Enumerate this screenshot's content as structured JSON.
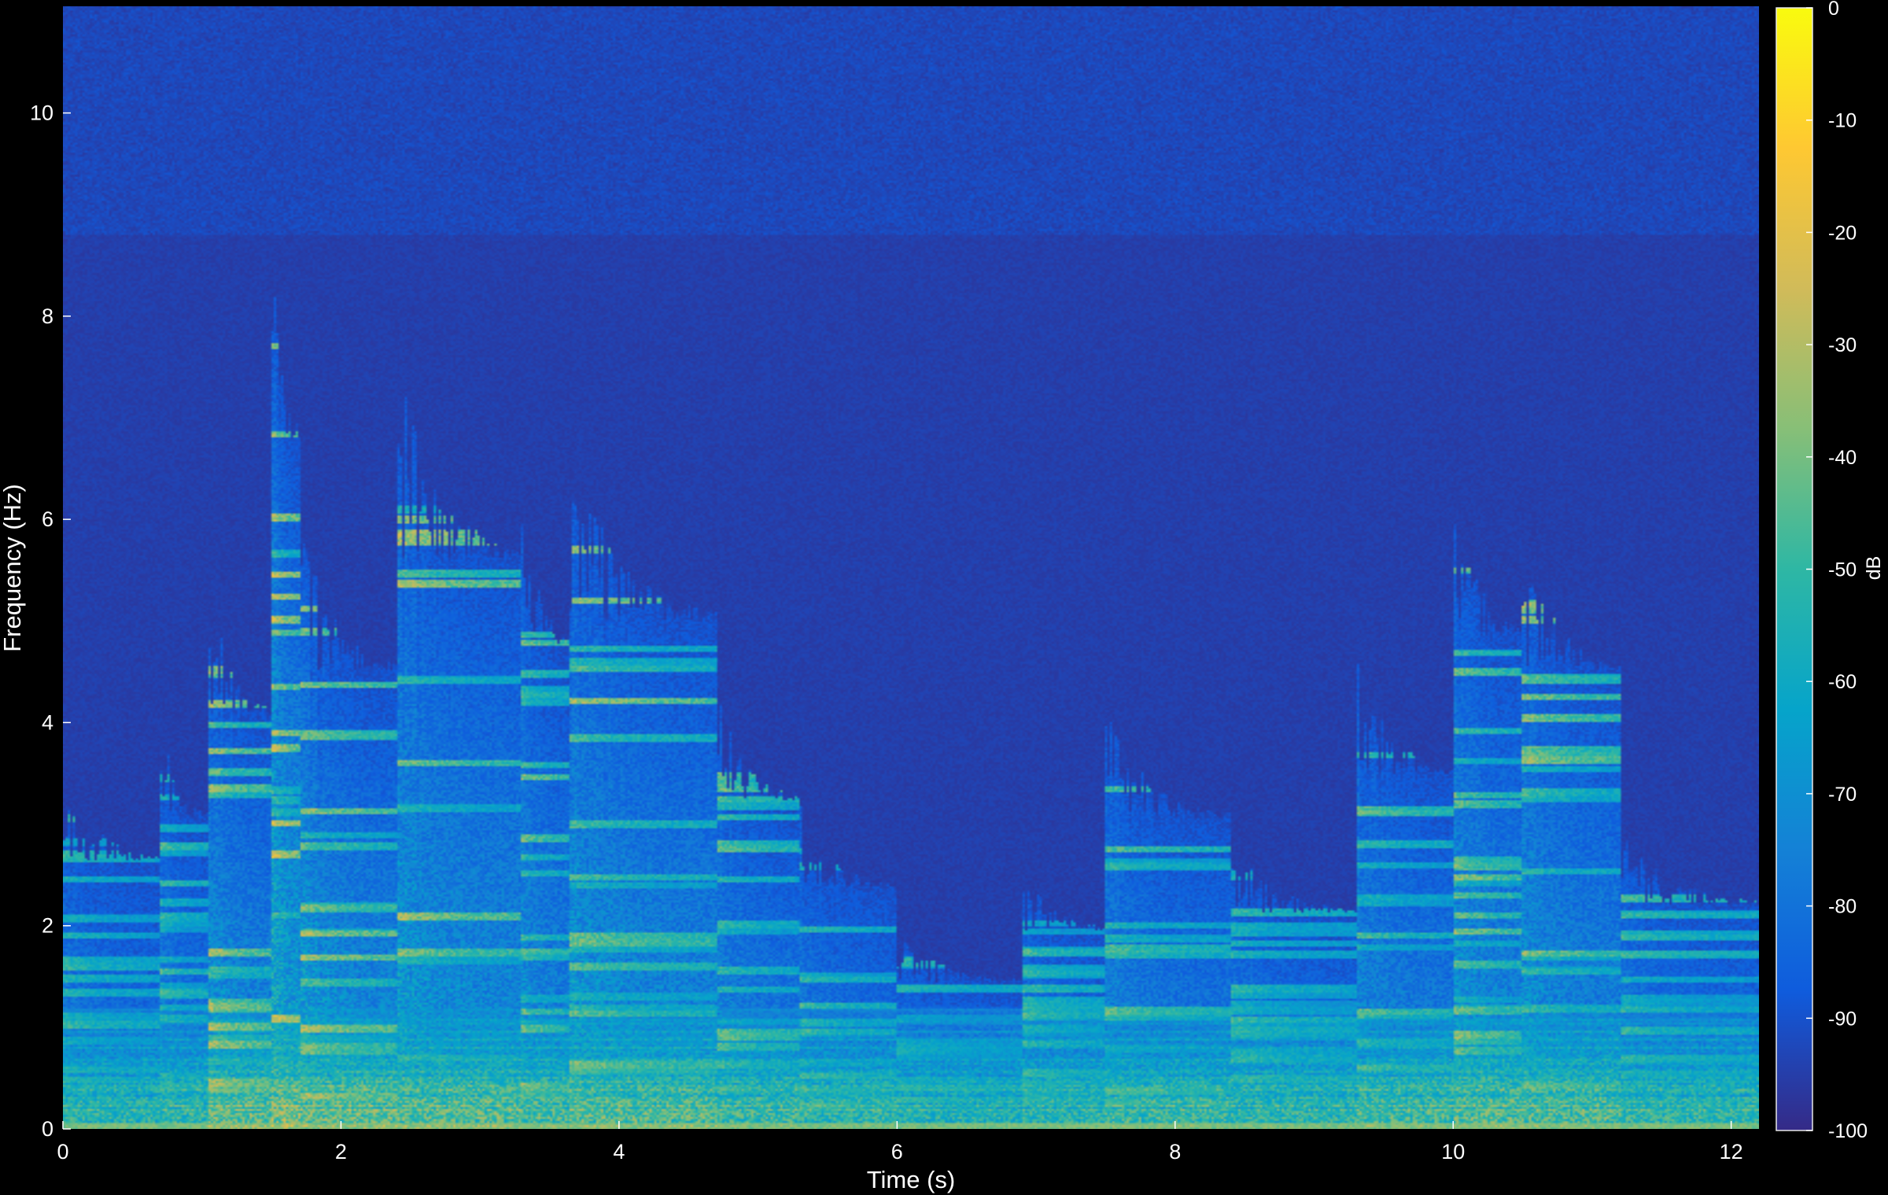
{
  "chart_data": {
    "type": "heatmap",
    "subtype": "spectrogram",
    "xlabel": "Time (s)",
    "ylabel": "Frequency (Hz)",
    "colorbar_label": "dB",
    "xlim": [
      0,
      12.2
    ],
    "ylim": [
      0,
      11.05
    ],
    "x_ticks": [
      0,
      2,
      4,
      6,
      8,
      10,
      12
    ],
    "y_ticks": [
      0,
      2,
      4,
      6,
      8,
      10
    ],
    "clim": [
      -100,
      0
    ],
    "colorbar_ticks": [
      0,
      -10,
      -20,
      -30,
      -40,
      -50,
      -60,
      -70,
      -80,
      -90,
      -100
    ],
    "colormap": "parula",
    "colors": {
      "background": "#000000",
      "floor": "#3a2aa8",
      "colormap_stops": [
        "#352a87",
        "#0f5cdd",
        "#1481d6",
        "#06a4ca",
        "#2eb7a4",
        "#87bf77",
        "#d1bb59",
        "#fec832",
        "#f9fb0e"
      ]
    },
    "grid": false,
    "events": [
      {
        "t_start": 0.0,
        "t_end": 0.7,
        "max_freq": 3.1,
        "level": 0.35
      },
      {
        "t_start": 0.7,
        "t_end": 1.05,
        "max_freq": 3.6,
        "level": 0.4
      },
      {
        "t_start": 1.05,
        "t_end": 1.5,
        "max_freq": 4.8,
        "level": 0.62
      },
      {
        "t_start": 1.5,
        "t_end": 1.7,
        "max_freq": 8.0,
        "level": 0.78
      },
      {
        "t_start": 1.7,
        "t_end": 2.4,
        "max_freq": 5.3,
        "level": 0.64
      },
      {
        "t_start": 2.4,
        "t_end": 3.3,
        "max_freq": 6.6,
        "level": 0.6
      },
      {
        "t_start": 3.3,
        "t_end": 3.65,
        "max_freq": 5.6,
        "level": 0.52
      },
      {
        "t_start": 3.65,
        "t_end": 4.7,
        "max_freq": 5.9,
        "level": 0.58
      },
      {
        "t_start": 4.7,
        "t_end": 5.3,
        "max_freq": 3.8,
        "level": 0.46
      },
      {
        "t_start": 5.3,
        "t_end": 6.0,
        "max_freq": 2.8,
        "level": 0.38
      },
      {
        "t_start": 6.0,
        "t_end": 6.9,
        "max_freq": 1.7,
        "level": 0.3
      },
      {
        "t_start": 6.9,
        "t_end": 7.5,
        "max_freq": 2.3,
        "level": 0.36
      },
      {
        "t_start": 7.5,
        "t_end": 8.4,
        "max_freq": 3.6,
        "level": 0.44
      },
      {
        "t_start": 8.4,
        "t_end": 9.3,
        "max_freq": 2.5,
        "level": 0.38
      },
      {
        "t_start": 9.3,
        "t_end": 10.0,
        "max_freq": 4.1,
        "level": 0.5
      },
      {
        "t_start": 10.0,
        "t_end": 10.5,
        "max_freq": 5.7,
        "level": 0.58
      },
      {
        "t_start": 10.5,
        "t_end": 11.2,
        "max_freq": 5.3,
        "level": 0.55
      },
      {
        "t_start": 11.2,
        "t_end": 12.2,
        "max_freq": 2.6,
        "level": 0.38
      }
    ]
  }
}
